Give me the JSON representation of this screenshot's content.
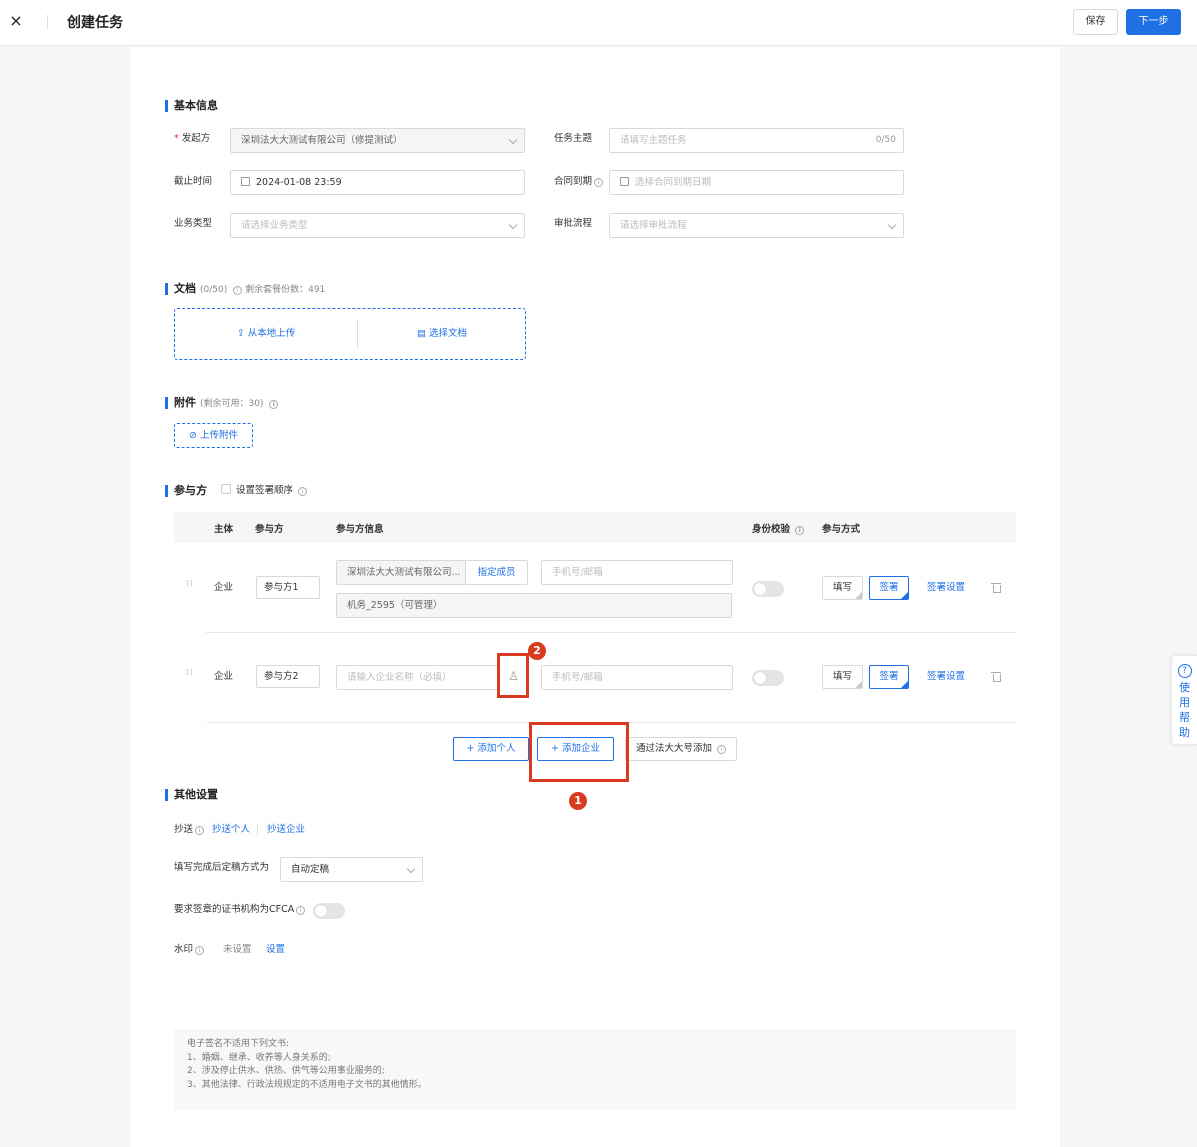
{
  "header": {
    "close_icon": "×",
    "title": "创建任务",
    "save_label": "保存",
    "next_label": "下一步"
  },
  "basic": {
    "title": "基本信息",
    "initiator_label": "发起方",
    "initiator_required": "*",
    "initiator_value": "深圳法大大测试有限公司（修提测试）",
    "subject_label": "任务主题",
    "subject_placeholder": "请填写主题任务",
    "subject_count": "0/50",
    "deadline_label": "截止时间",
    "deadline_value": "2024-01-08 23:59",
    "expire_label": "合同到期",
    "expire_placeholder": "选择合同到期日期",
    "biztype_label": "业务类型",
    "biztype_placeholder": "请选择业务类型",
    "approval_label": "审批流程",
    "approval_placeholder": "请选择审批流程"
  },
  "docs": {
    "title": "文档",
    "count": "(0/50)",
    "quota": "剩余套餐份数：491",
    "upload_local": "从本地上传",
    "choose_doc": "选择文档"
  },
  "attach": {
    "title": "附件",
    "remain": "(剩余可用：30)",
    "upload": "上传附件"
  },
  "parties": {
    "title": "参与方",
    "order_label": "设置签署顺序",
    "headers": {
      "subject": "主体",
      "party": "参与方",
      "info": "参与方信息",
      "verify": "身份校验",
      "mode": "参与方式"
    },
    "rows": [
      {
        "subject": "企业",
        "name": "参与方1",
        "company": "深圳法大大测试有限公司...",
        "assign": "指定成员",
        "phone_placeholder": "手机号/邮箱",
        "member": "机务_2595（可管理）",
        "fill": "填写",
        "sign": "签署",
        "settings": "签署设置"
      },
      {
        "subject": "企业",
        "name": "参与方2",
        "company_placeholder": "请输入企业名称（必填）",
        "phone_placeholder": "手机号/邮箱",
        "fill": "填写",
        "sign": "签署",
        "settings": "签署设置"
      }
    ],
    "add_person": "+ 添加个人",
    "add_company": "+ 添加企业",
    "add_by_account": "通过法大大号添加"
  },
  "other": {
    "title": "其他设置",
    "cc_label": "抄送",
    "cc_person": "抄送个人",
    "cc_company": "抄送企业",
    "finalize_label": "填写完成后定稿方式为",
    "finalize_value": "自动定稿",
    "cfca_label": "要求签章的证书机构为CFCA",
    "watermark_label": "水印",
    "watermark_status": "未设置",
    "watermark_set": "设置"
  },
  "notice": [
    "电子签名不适用下列文书:",
    "1、婚姻、继承、收养等人身关系的;",
    "2、涉及停止供水、供热、供气等公用事业服务的;",
    "3、其他法律、行政法规规定的不适用电子文书的其他情形。"
  ],
  "annotations": {
    "badge1": "1",
    "badge2": "2"
  },
  "help": {
    "q": "?",
    "text": "使用帮助"
  },
  "colors": {
    "accent": "#1f6fe5",
    "highlight": "#d83b1f"
  }
}
